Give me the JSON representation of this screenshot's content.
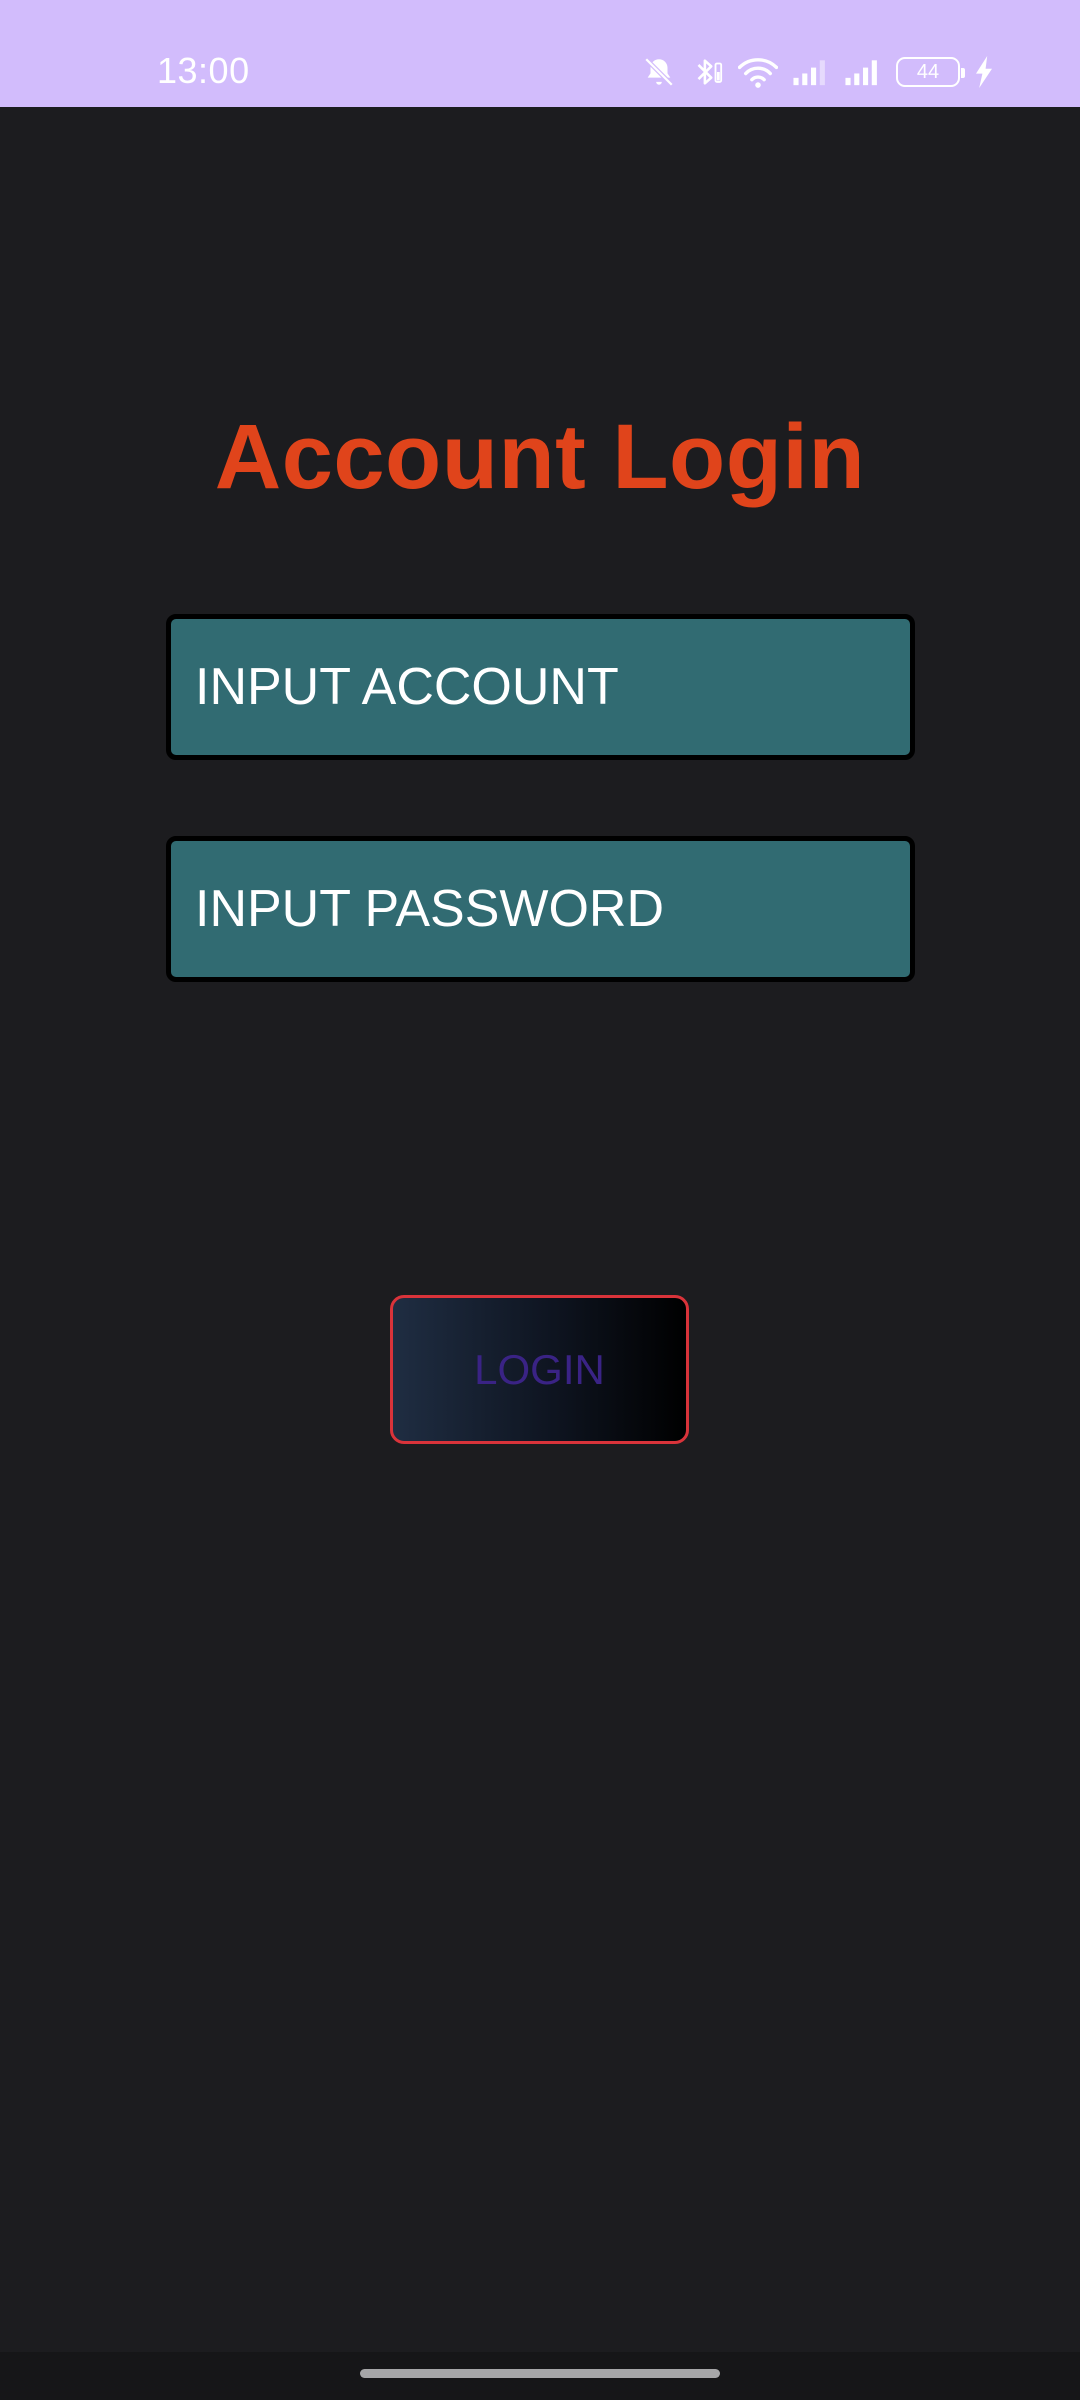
{
  "status_bar": {
    "time": "13:00",
    "battery_level": "44",
    "icons": [
      "bell-off-icon",
      "bluetooth-icon",
      "wifi-icon",
      "signal-icon",
      "signal-icon",
      "battery-icon",
      "charging-icon"
    ]
  },
  "login_form": {
    "title": "Account Login",
    "account_placeholder": "INPUT ACCOUNT",
    "password_placeholder": "INPUT PASSWORD",
    "login_label": "LOGIN"
  },
  "colors": {
    "status_bar_bg": "#d2bcfc",
    "background": "#1c1c1f",
    "title": "#e0441b",
    "input_bg": "#316b72",
    "login_border": "#d9333a",
    "login_text": "#3a2385"
  }
}
